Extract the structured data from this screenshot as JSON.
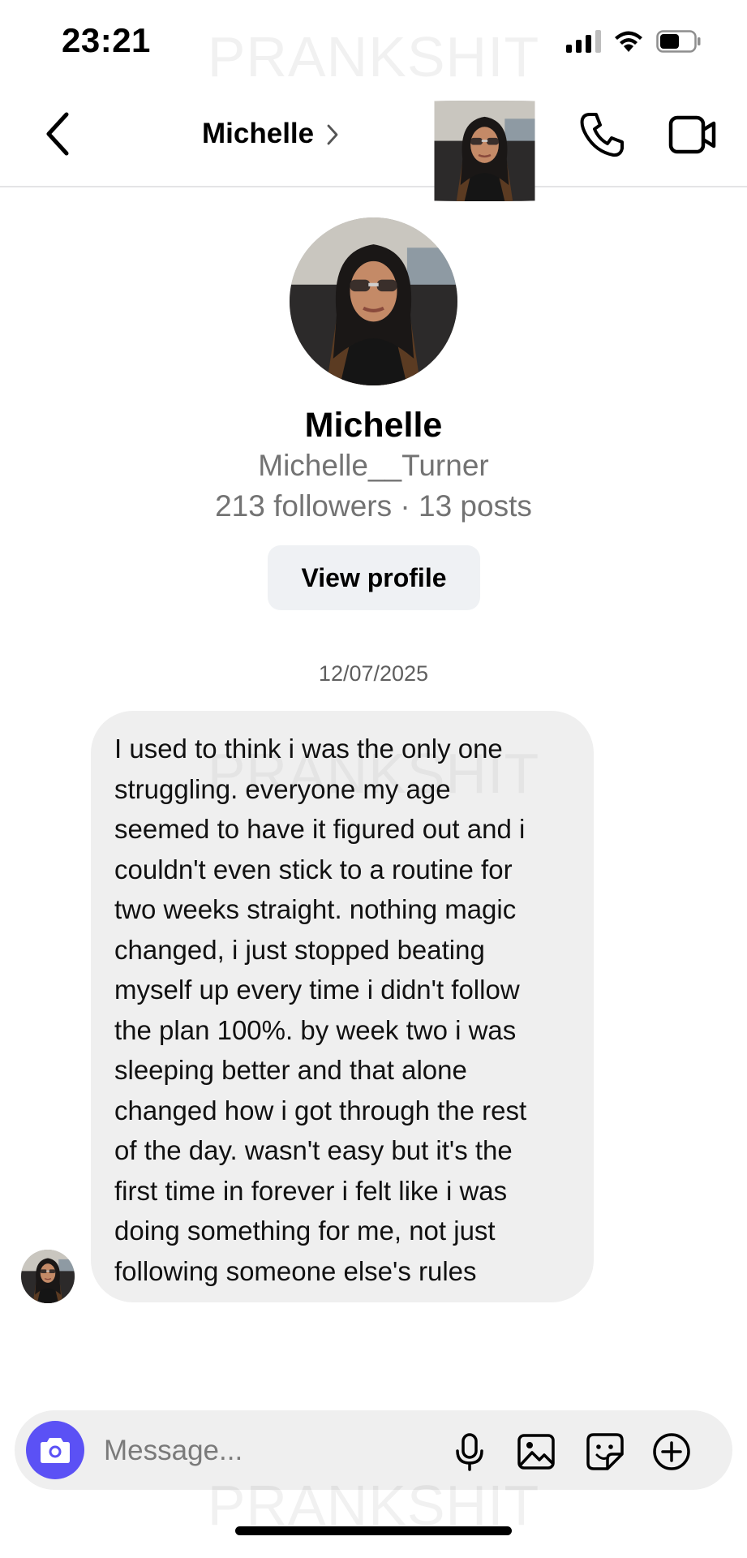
{
  "status_bar": {
    "time": "23:21",
    "icons": [
      "signal-icon",
      "wifi-icon",
      "battery-icon"
    ]
  },
  "watermark": "PRANKSHIT",
  "header": {
    "back_icon": "chevron-left-icon",
    "contact_name": "Michelle",
    "chevron_icon": "chevron-right-icon",
    "actions": [
      "phone-icon",
      "video-camera-icon"
    ]
  },
  "profile": {
    "name": "Michelle",
    "username": "Michelle__Turner",
    "stats": "213 followers · 13 posts",
    "view_profile_label": "View profile"
  },
  "conversation": {
    "date": "12/07/2025",
    "messages": [
      {
        "sender": "Michelle",
        "lines": [
          "I used to think i was the only one",
          "struggling. everyone my age",
          "seemed to have it figured out and i",
          "couldn't even stick to a routine for",
          "two weeks straight. nothing magic",
          "changed, i just stopped beating",
          "myself up every time i didn't follow",
          "the plan 100%. by week two i was",
          "sleeping better and that alone",
          "changed how i got through the rest",
          "of the day. wasn't easy but it's the",
          "first time in forever i felt like i was",
          "doing something for me, not just",
          "following someone else's rules"
        ]
      }
    ]
  },
  "composer": {
    "placeholder": "Message...",
    "icons": [
      "camera-icon",
      "microphone-icon",
      "gallery-icon",
      "sticker-icon",
      "plus-circle-icon"
    ]
  },
  "colors": {
    "accent": "#5b51f5",
    "bubble": "#efefef",
    "secondary_text": "#737373",
    "button_bg": "#eff1f4"
  }
}
